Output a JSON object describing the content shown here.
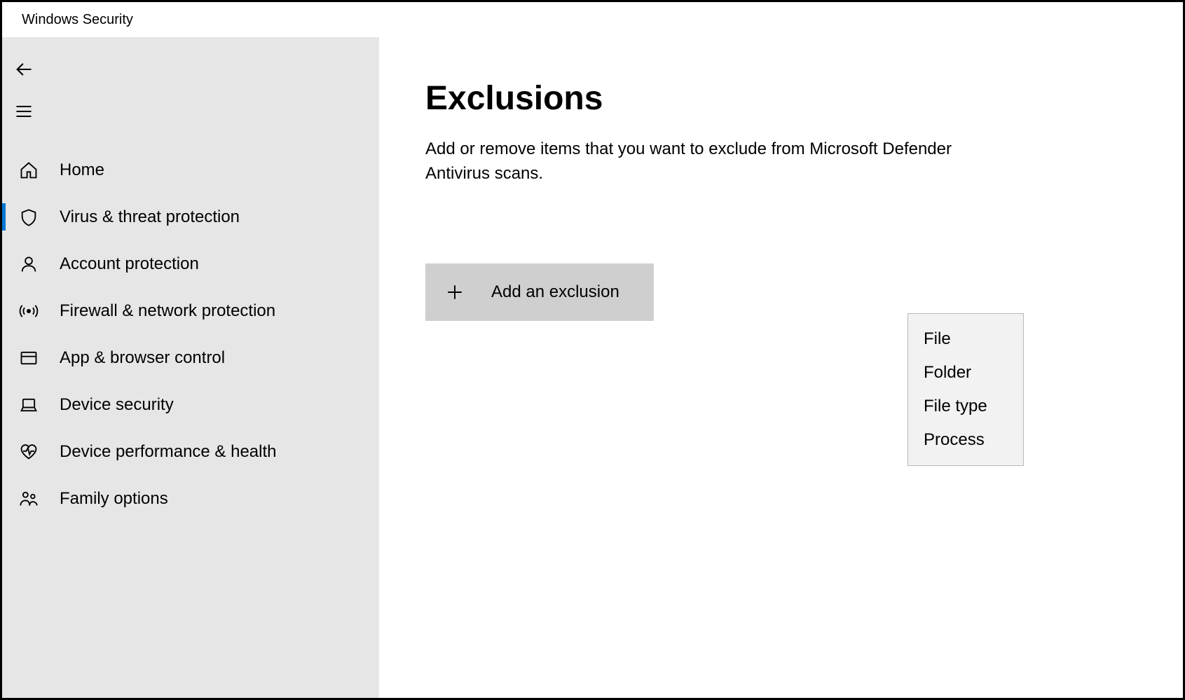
{
  "app_title": "Windows Security",
  "sidebar": {
    "items": [
      {
        "label": "Home",
        "icon": "home-icon",
        "selected": false
      },
      {
        "label": "Virus & threat protection",
        "icon": "shield-icon",
        "selected": true
      },
      {
        "label": "Account protection",
        "icon": "person-icon",
        "selected": false
      },
      {
        "label": "Firewall & network protection",
        "icon": "broadcast-icon",
        "selected": false
      },
      {
        "label": "App & browser control",
        "icon": "window-icon",
        "selected": false
      },
      {
        "label": "Device security",
        "icon": "laptop-icon",
        "selected": false
      },
      {
        "label": "Device performance & health",
        "icon": "heart-icon",
        "selected": false
      },
      {
        "label": "Family options",
        "icon": "family-icon",
        "selected": false
      }
    ]
  },
  "main": {
    "title": "Exclusions",
    "description": "Add or remove items that you want to exclude from Microsoft Defender Antivirus scans.",
    "add_button_label": "Add an exclusion",
    "dropdown_options": [
      "File",
      "Folder",
      "File type",
      "Process"
    ]
  },
  "colors": {
    "accent": "#0078d4",
    "sidebar_bg": "#e6e6e6",
    "button_bg": "#cfcfcf",
    "dropdown_bg": "#f2f2f2",
    "dropdown_border": "#b8b8b8"
  }
}
